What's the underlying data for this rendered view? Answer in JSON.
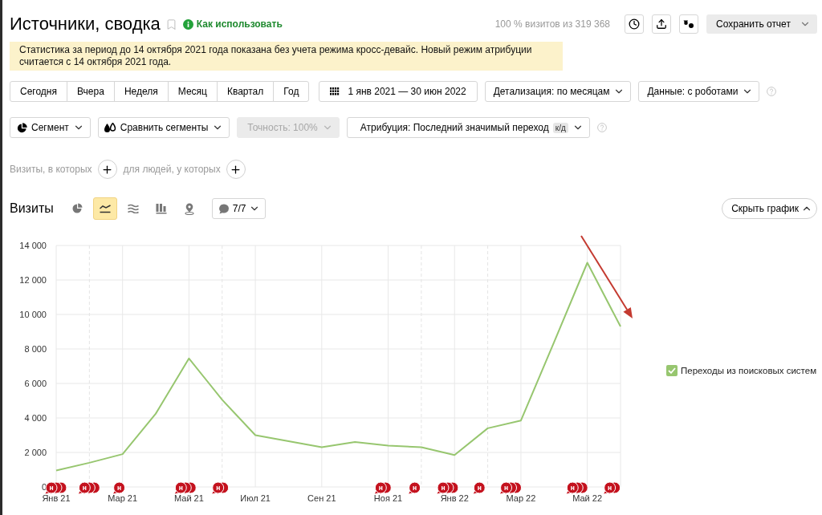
{
  "header": {
    "title": "Источники, сводка",
    "help_link": "Как использовать",
    "visits_share": "100 % визитов из 319 368",
    "save_button": "Сохранить отчет"
  },
  "notice": "Статистика за период до 14 октября 2021 года показана без учета режима кросс-девайс. Новый режим атрибуции считается с 14 октября 2021 года.",
  "periods": [
    {
      "label": "Сегодня",
      "selected": false
    },
    {
      "label": "Вчера",
      "selected": false
    },
    {
      "label": "Неделя",
      "selected": false
    },
    {
      "label": "Месяц",
      "selected": false
    },
    {
      "label": "Квартал",
      "selected": false
    },
    {
      "label": "Год",
      "selected": false
    }
  ],
  "date_range": "1 янв 2021 — 30 июн 2022",
  "detail_dropdown": "Детализация: по месяцам",
  "data_dropdown": "Данные: с роботами",
  "segment_dropdown": "Сегмент",
  "compare_dropdown": "Сравнить сегменты",
  "accuracy": {
    "label": "Точность: 100%",
    "disabled": true
  },
  "attribution": {
    "label": "Атрибуция: Последний значимый переход",
    "badge": "к/д"
  },
  "filter_labels": [
    "Визиты, в которых",
    "для людей, у которых"
  ],
  "chart_panel": {
    "title": "Визиты",
    "chart_types": [
      {
        "kind": "pie",
        "selected": false
      },
      {
        "kind": "line",
        "selected": true
      },
      {
        "kind": "stacked",
        "selected": false
      },
      {
        "kind": "columns",
        "selected": false
      },
      {
        "kind": "map",
        "selected": false
      }
    ],
    "notes_button": "7/7",
    "hide_button": "Скрыть график",
    "legend_checked": true,
    "chart_data": {
      "type": "line",
      "grid": true,
      "categories": [
        "Янв 21",
        null,
        "Мар 21",
        null,
        "Май 21",
        null,
        "Июл 21",
        null,
        "Сен 21",
        null,
        "Ноя 21",
        null,
        "Янв 22",
        null,
        "Мар 22",
        null,
        "Май 22",
        null
      ],
      "ylim": [
        0,
        14000
      ],
      "yticks": [
        0,
        {
          "value": 2000,
          "label": "2 000"
        },
        {
          "value": 4000,
          "label": "4 000"
        },
        {
          "value": 6000,
          "label": "6 000"
        },
        {
          "value": 8000,
          "label": "8 000"
        },
        {
          "value": 10000,
          "label": "10 000"
        },
        {
          "value": 12000,
          "label": "12 000"
        },
        {
          "value": 14000,
          "label": "14 000"
        }
      ],
      "series": [
        {
          "name": "Переходы из поисковых систем",
          "color": "#97c66f",
          "values": [
            950,
            1400,
            1900,
            4250,
            7450,
            5050,
            3000,
            2650,
            2300,
            2600,
            2400,
            2300,
            1850,
            3400,
            3850,
            8400,
            13000,
            9300
          ]
        }
      ]
    },
    "note_markers": [
      {
        "kind": "triple",
        "label": "н"
      },
      {
        "kind": "triple",
        "label": "н"
      },
      {
        "kind": "single",
        "label": "н"
      },
      {
        "kind": "triple",
        "label": "н"
      },
      {
        "kind": "double",
        "label": "н"
      },
      {
        "kind": "double",
        "label": "н"
      },
      {
        "kind": "single",
        "label": "н"
      },
      {
        "kind": "triple",
        "label": "н"
      },
      {
        "kind": "single",
        "label": "н"
      },
      {
        "kind": "triple",
        "label": "н"
      },
      {
        "kind": "triple",
        "label": "н"
      },
      {
        "kind": "double",
        "label": "н"
      }
    ]
  }
}
